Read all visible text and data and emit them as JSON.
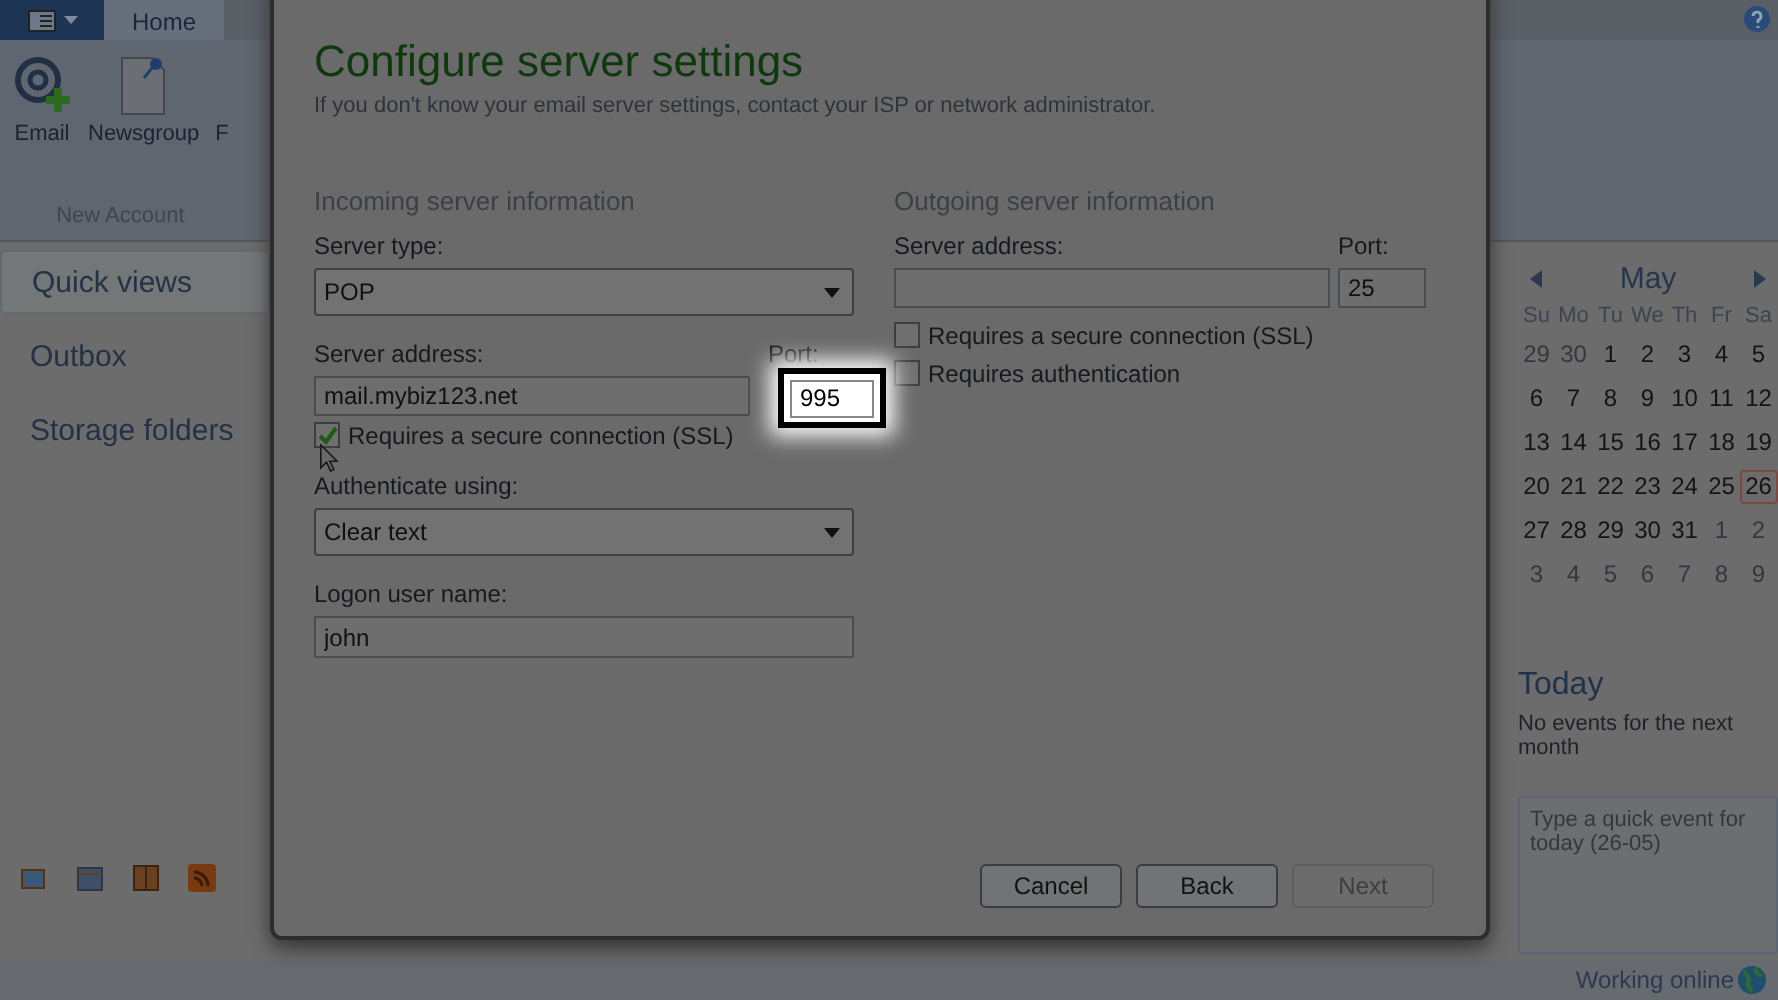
{
  "ribbon": {
    "tabs": [
      {
        "label": "Home",
        "selected": true
      }
    ],
    "buttons": [
      {
        "label": "Email",
        "kind": "email"
      },
      {
        "label": "Newsgroup",
        "kind": "newsgroup"
      },
      {
        "label": "F",
        "kind": "cut"
      }
    ],
    "group_label": "New Account"
  },
  "nav": [
    {
      "label": "Quick views",
      "selected": true
    },
    {
      "label": "Outbox",
      "selected": false
    },
    {
      "label": "Storage folders",
      "selected": false
    }
  ],
  "calendar": {
    "month": "May",
    "weekdays": [
      "Su",
      "Mo",
      "Tu",
      "We",
      "Th",
      "Fr",
      "Sa"
    ],
    "days": [
      {
        "day": "29",
        "in_month": false,
        "selected": false
      },
      {
        "day": "30",
        "in_month": false,
        "selected": false
      },
      {
        "day": "1",
        "in_month": true,
        "selected": false
      },
      {
        "day": "2",
        "in_month": true,
        "selected": false
      },
      {
        "day": "3",
        "in_month": true,
        "selected": false
      },
      {
        "day": "4",
        "in_month": true,
        "selected": false
      },
      {
        "day": "5",
        "in_month": true,
        "selected": false
      },
      {
        "day": "6",
        "in_month": true,
        "selected": false
      },
      {
        "day": "7",
        "in_month": true,
        "selected": false
      },
      {
        "day": "8",
        "in_month": true,
        "selected": false
      },
      {
        "day": "9",
        "in_month": true,
        "selected": false
      },
      {
        "day": "10",
        "in_month": true,
        "selected": false
      },
      {
        "day": "11",
        "in_month": true,
        "selected": false
      },
      {
        "day": "12",
        "in_month": true,
        "selected": false
      },
      {
        "day": "13",
        "in_month": true,
        "selected": false
      },
      {
        "day": "14",
        "in_month": true,
        "selected": false
      },
      {
        "day": "15",
        "in_month": true,
        "selected": false
      },
      {
        "day": "16",
        "in_month": true,
        "selected": false
      },
      {
        "day": "17",
        "in_month": true,
        "selected": false
      },
      {
        "day": "18",
        "in_month": true,
        "selected": false
      },
      {
        "day": "19",
        "in_month": true,
        "selected": false
      },
      {
        "day": "20",
        "in_month": true,
        "selected": false
      },
      {
        "day": "21",
        "in_month": true,
        "selected": false
      },
      {
        "day": "22",
        "in_month": true,
        "selected": false
      },
      {
        "day": "23",
        "in_month": true,
        "selected": false
      },
      {
        "day": "24",
        "in_month": true,
        "selected": false
      },
      {
        "day": "25",
        "in_month": true,
        "selected": false
      },
      {
        "day": "26",
        "in_month": true,
        "selected": true
      },
      {
        "day": "27",
        "in_month": true,
        "selected": false
      },
      {
        "day": "28",
        "in_month": true,
        "selected": false
      },
      {
        "day": "29",
        "in_month": true,
        "selected": false
      },
      {
        "day": "30",
        "in_month": true,
        "selected": false
      },
      {
        "day": "31",
        "in_month": true,
        "selected": false
      },
      {
        "day": "1",
        "in_month": false,
        "selected": false
      },
      {
        "day": "2",
        "in_month": false,
        "selected": false
      },
      {
        "day": "3",
        "in_month": false,
        "selected": false
      },
      {
        "day": "4",
        "in_month": false,
        "selected": false
      },
      {
        "day": "5",
        "in_month": false,
        "selected": false
      },
      {
        "day": "6",
        "in_month": false,
        "selected": false
      },
      {
        "day": "7",
        "in_month": false,
        "selected": false
      },
      {
        "day": "8",
        "in_month": false,
        "selected": false
      },
      {
        "day": "9",
        "in_month": false,
        "selected": false
      }
    ]
  },
  "today": {
    "title": "Today",
    "message": "No events for the next month",
    "quick_event": {
      "placeholder": "Type a quick event for today (26-05)"
    }
  },
  "status_bar": {
    "text": "Working online"
  },
  "dialog": {
    "title": "Configure server settings",
    "subtitle": "If you don't know your email server settings, contact your ISP or network administrator.",
    "incoming": {
      "heading": "Incoming server information",
      "server_type_label": "Server type:",
      "server_type": "POP",
      "address_label": "Server address:",
      "address": "mail.mybiz123.net",
      "port_label": "Port:",
      "port": "995",
      "port_highlighted": true,
      "ssl": {
        "label": "Requires a secure connection (SSL)",
        "checked": true
      },
      "auth_label": "Authenticate using:",
      "auth": "Clear text",
      "logon_label": "Logon user name:",
      "logon": "john"
    },
    "outgoing": {
      "heading": "Outgoing server information",
      "address_label": "Server address:",
      "port_label": "Port:",
      "port": "25",
      "checks": [
        {
          "label": "Requires a secure connection (SSL)",
          "checked": false
        },
        {
          "label": "Requires authentication",
          "checked": false
        }
      ]
    },
    "buttons": [
      {
        "label": "Cancel",
        "disabled": false
      },
      {
        "label": "Back",
        "disabled": false
      },
      {
        "label": "Next",
        "disabled": true
      }
    ]
  }
}
